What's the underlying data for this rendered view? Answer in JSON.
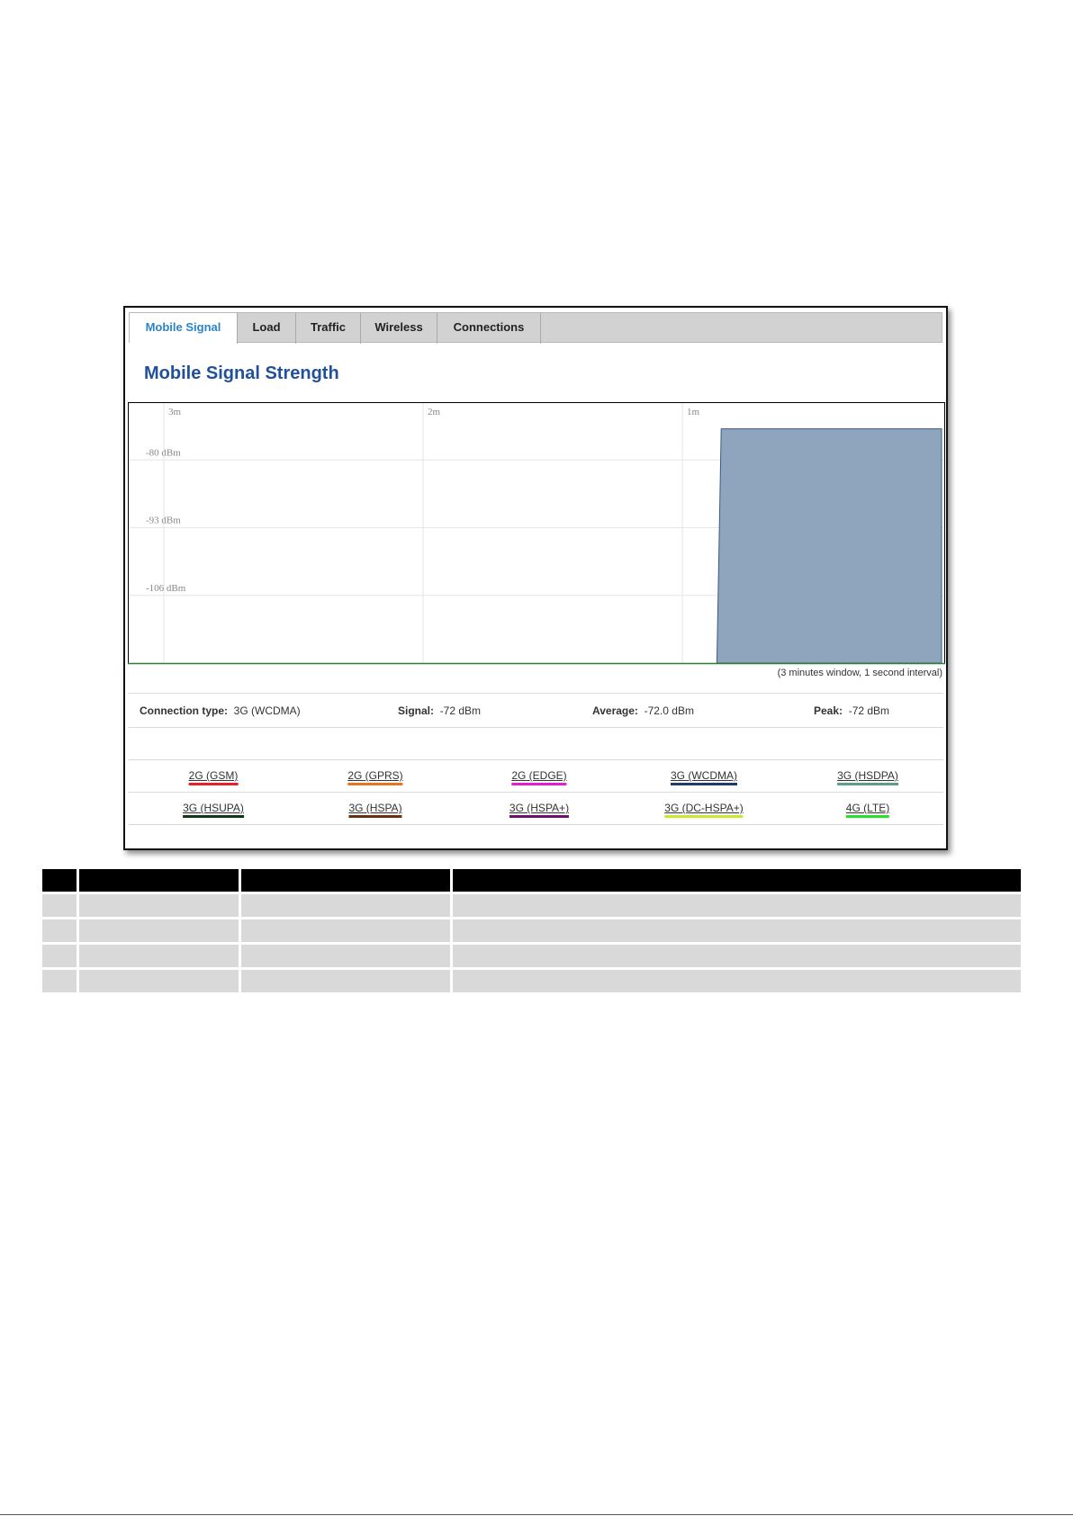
{
  "tabs": [
    {
      "label": "Mobile Signal",
      "active": true
    },
    {
      "label": "Load",
      "active": false
    },
    {
      "label": "Traffic",
      "active": false
    },
    {
      "label": "Wireless",
      "active": false
    },
    {
      "label": "Connections",
      "active": false
    }
  ],
  "page_title": "Mobile Signal Strength",
  "graph_note": "(3 minutes window, 1 second interval)",
  "chart_data": {
    "type": "area",
    "x_labels": [
      "3m",
      "2m",
      "1m"
    ],
    "y_labels": [
      "-80 dBm",
      "-93 dBm",
      "-106 dBm"
    ],
    "y_ticks": [
      -80,
      -93,
      -106
    ],
    "y_range": [
      -119,
      -72
    ],
    "x_unit": "seconds ago",
    "x_range": [
      190,
      0
    ],
    "series": [
      {
        "color": "#8fa5bd",
        "points": [
          [
            52,
            -119
          ],
          [
            51,
            -74
          ],
          [
            0,
            -74
          ]
        ]
      }
    ]
  },
  "stats": {
    "connection_type_label": "Connection type:",
    "connection_type_value": "3G (WCDMA)",
    "signal_label": "Signal:",
    "signal_value": "-72 dBm",
    "average_label": "Average:",
    "average_value": "-72.0 dBm",
    "peak_label": "Peak:",
    "peak_value": "-72 dBm"
  },
  "legend": {
    "row1": [
      {
        "label": "2G (GSM)",
        "color": "#e8202a"
      },
      {
        "label": "2G (GPRS)",
        "color": "#e87420"
      },
      {
        "label": "2G (EDGE)",
        "color": "#e020d0"
      },
      {
        "label": "3G (WCDMA)",
        "color": "#1e3c6e"
      },
      {
        "label": "3G (HSDPA)",
        "color": "#5e9c8c"
      }
    ],
    "row2": [
      {
        "label": "3G (HSUPA)",
        "color": "#0c3a16"
      },
      {
        "label": "3G (HSPA)",
        "color": "#6a3010"
      },
      {
        "label": "3G (HSPA+)",
        "color": "#6c1070"
      },
      {
        "label": "3G (DC-HSPA+)",
        "color": "#c8e830"
      },
      {
        "label": "4G (LTE)",
        "color": "#28e028"
      }
    ]
  }
}
